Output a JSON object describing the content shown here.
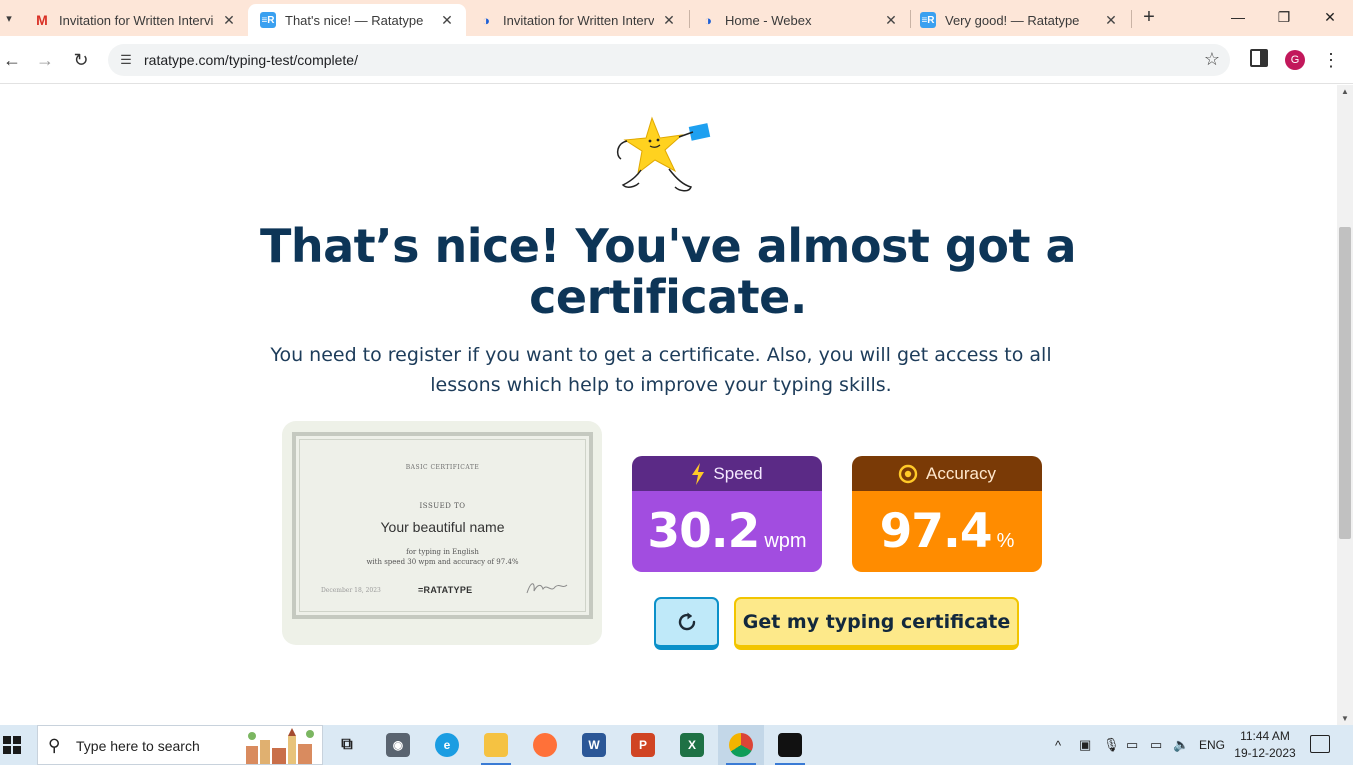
{
  "browser": {
    "tabs": [
      {
        "title": "Invitation for Written Interview",
        "favicon": "gmail-icon"
      },
      {
        "title": "That's nice! — Ratatype",
        "favicon": "ratatype-icon",
        "active": true
      },
      {
        "title": "Invitation for Written Interview",
        "favicon": "webex-icon"
      },
      {
        "title": "Home - Webex",
        "favicon": "webex-icon"
      },
      {
        "title": "Very good! — Ratatype",
        "favicon": "ratatype-icon"
      }
    ],
    "new_tab": "+",
    "url": "ratatype.com/typing-test/complete/",
    "profile_initial": "G"
  },
  "page": {
    "headline": "That’s nice! You've almost got a certificate.",
    "subtext": "You need to register if you want to get a certificate. Also, you will get access to all lessons which help to improve your typing skills.",
    "certificate": {
      "title": "BASIC CERTIFICATE",
      "issued_to": "ISSUED TO",
      "name": "Your beautiful name",
      "for_line": "for typing in English",
      "with_line": "with speed 30 wpm and accuracy of 97.4%",
      "date": "December 18, 2023",
      "logo": "=RATATYPE"
    },
    "speed": {
      "label": "Speed",
      "value": "30.2",
      "unit": "wpm",
      "color": "#a24de0"
    },
    "accuracy": {
      "label": "Accuracy",
      "value": "97.4",
      "unit": "%",
      "color": "#ff8c00"
    },
    "restart_icon": "refresh-icon",
    "certificate_button": "Get my typing certificate"
  },
  "taskbar": {
    "search_placeholder": "Type here to search",
    "apps": [
      "task-view-icon",
      "camera-icon",
      "edge-icon",
      "file-explorer-icon",
      "firefox-icon",
      "word-icon",
      "powerpoint-icon",
      "excel-icon",
      "chrome-icon",
      "webex-icon"
    ],
    "language": "ENG",
    "time": "11:44 AM",
    "date": "19-12-2023"
  }
}
